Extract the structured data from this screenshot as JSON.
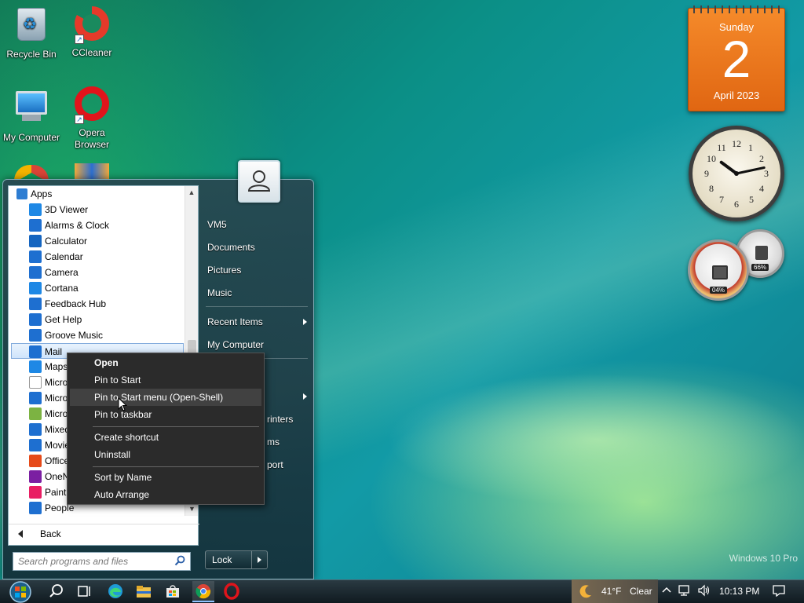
{
  "desktop": {
    "icons": [
      {
        "label": "Recycle Bin",
        "icon": "recycle-bin-icon"
      },
      {
        "label": "CCleaner",
        "icon": "ccleaner-icon"
      },
      {
        "label": "My Computer",
        "icon": "my-computer-icon"
      },
      {
        "label": "Opera Browser",
        "icon": "opera-icon"
      }
    ]
  },
  "gadgets": {
    "calendar": {
      "weekday": "Sunday",
      "day": "2",
      "month_year": "April 2023"
    },
    "clock": {
      "hour": 10,
      "minute": 13
    },
    "meters": {
      "cpu": "04%",
      "memory": "66%"
    }
  },
  "start_menu": {
    "apps_header": "Apps",
    "apps": [
      {
        "label": "3D Viewer",
        "color": "#1e88e5"
      },
      {
        "label": "Alarms & Clock",
        "color": "#1e6fd0"
      },
      {
        "label": "Calculator",
        "color": "#1565c0"
      },
      {
        "label": "Calendar",
        "color": "#1e6fd0"
      },
      {
        "label": "Camera",
        "color": "#1e6fd0"
      },
      {
        "label": "Cortana",
        "color": "#1e88e5"
      },
      {
        "label": "Feedback Hub",
        "color": "#1e6fd0"
      },
      {
        "label": "Get Help",
        "color": "#1e6fd0"
      },
      {
        "label": "Groove Music",
        "color": "#1e6fd0"
      },
      {
        "label": "Mail",
        "color": "#1e6fd0"
      },
      {
        "label": "Maps",
        "color": "#1e88e5"
      },
      {
        "label": "Micro",
        "color": "#ffffff"
      },
      {
        "label": "Micro",
        "color": "#1e6fd0"
      },
      {
        "label": "Micro",
        "color": "#7cb342"
      },
      {
        "label": "Mixed",
        "color": "#1e6fd0"
      },
      {
        "label": "Movie",
        "color": "#1e6fd0"
      },
      {
        "label": "Office",
        "color": "#e64a19"
      },
      {
        "label": "OneN",
        "color": "#7b1fa2"
      },
      {
        "label": "Paint",
        "color": "#e91e63"
      },
      {
        "label": "People",
        "color": "#1e6fd0"
      }
    ],
    "selected_app": "Mail",
    "back_label": "Back",
    "search_placeholder": "Search programs and files",
    "right": {
      "user": "VM5",
      "documents": "Documents",
      "pictures": "Pictures",
      "music": "Music",
      "recent_items": "Recent Items",
      "my_computer": "My Computer",
      "printers_partial": "rinters",
      "items_partial": "ms",
      "support_partial": "port"
    },
    "lock_label": "Lock"
  },
  "context_menu": {
    "items": [
      {
        "label": "Open",
        "bold": true
      },
      {
        "label": "Pin to Start"
      },
      {
        "label": "Pin to Start menu (Open-Shell)",
        "hover": true
      },
      {
        "label": "Pin to taskbar"
      },
      {
        "label": "Create shortcut"
      },
      {
        "label": "Uninstall"
      },
      {
        "label": "Sort by Name"
      },
      {
        "label": "Auto Arrange"
      }
    ]
  },
  "taskbar": {
    "weather_temp": "41°F",
    "weather_cond": "Clear",
    "time": "10:13 PM"
  },
  "watermark": {
    "line1": "Windows 10 Pro"
  }
}
